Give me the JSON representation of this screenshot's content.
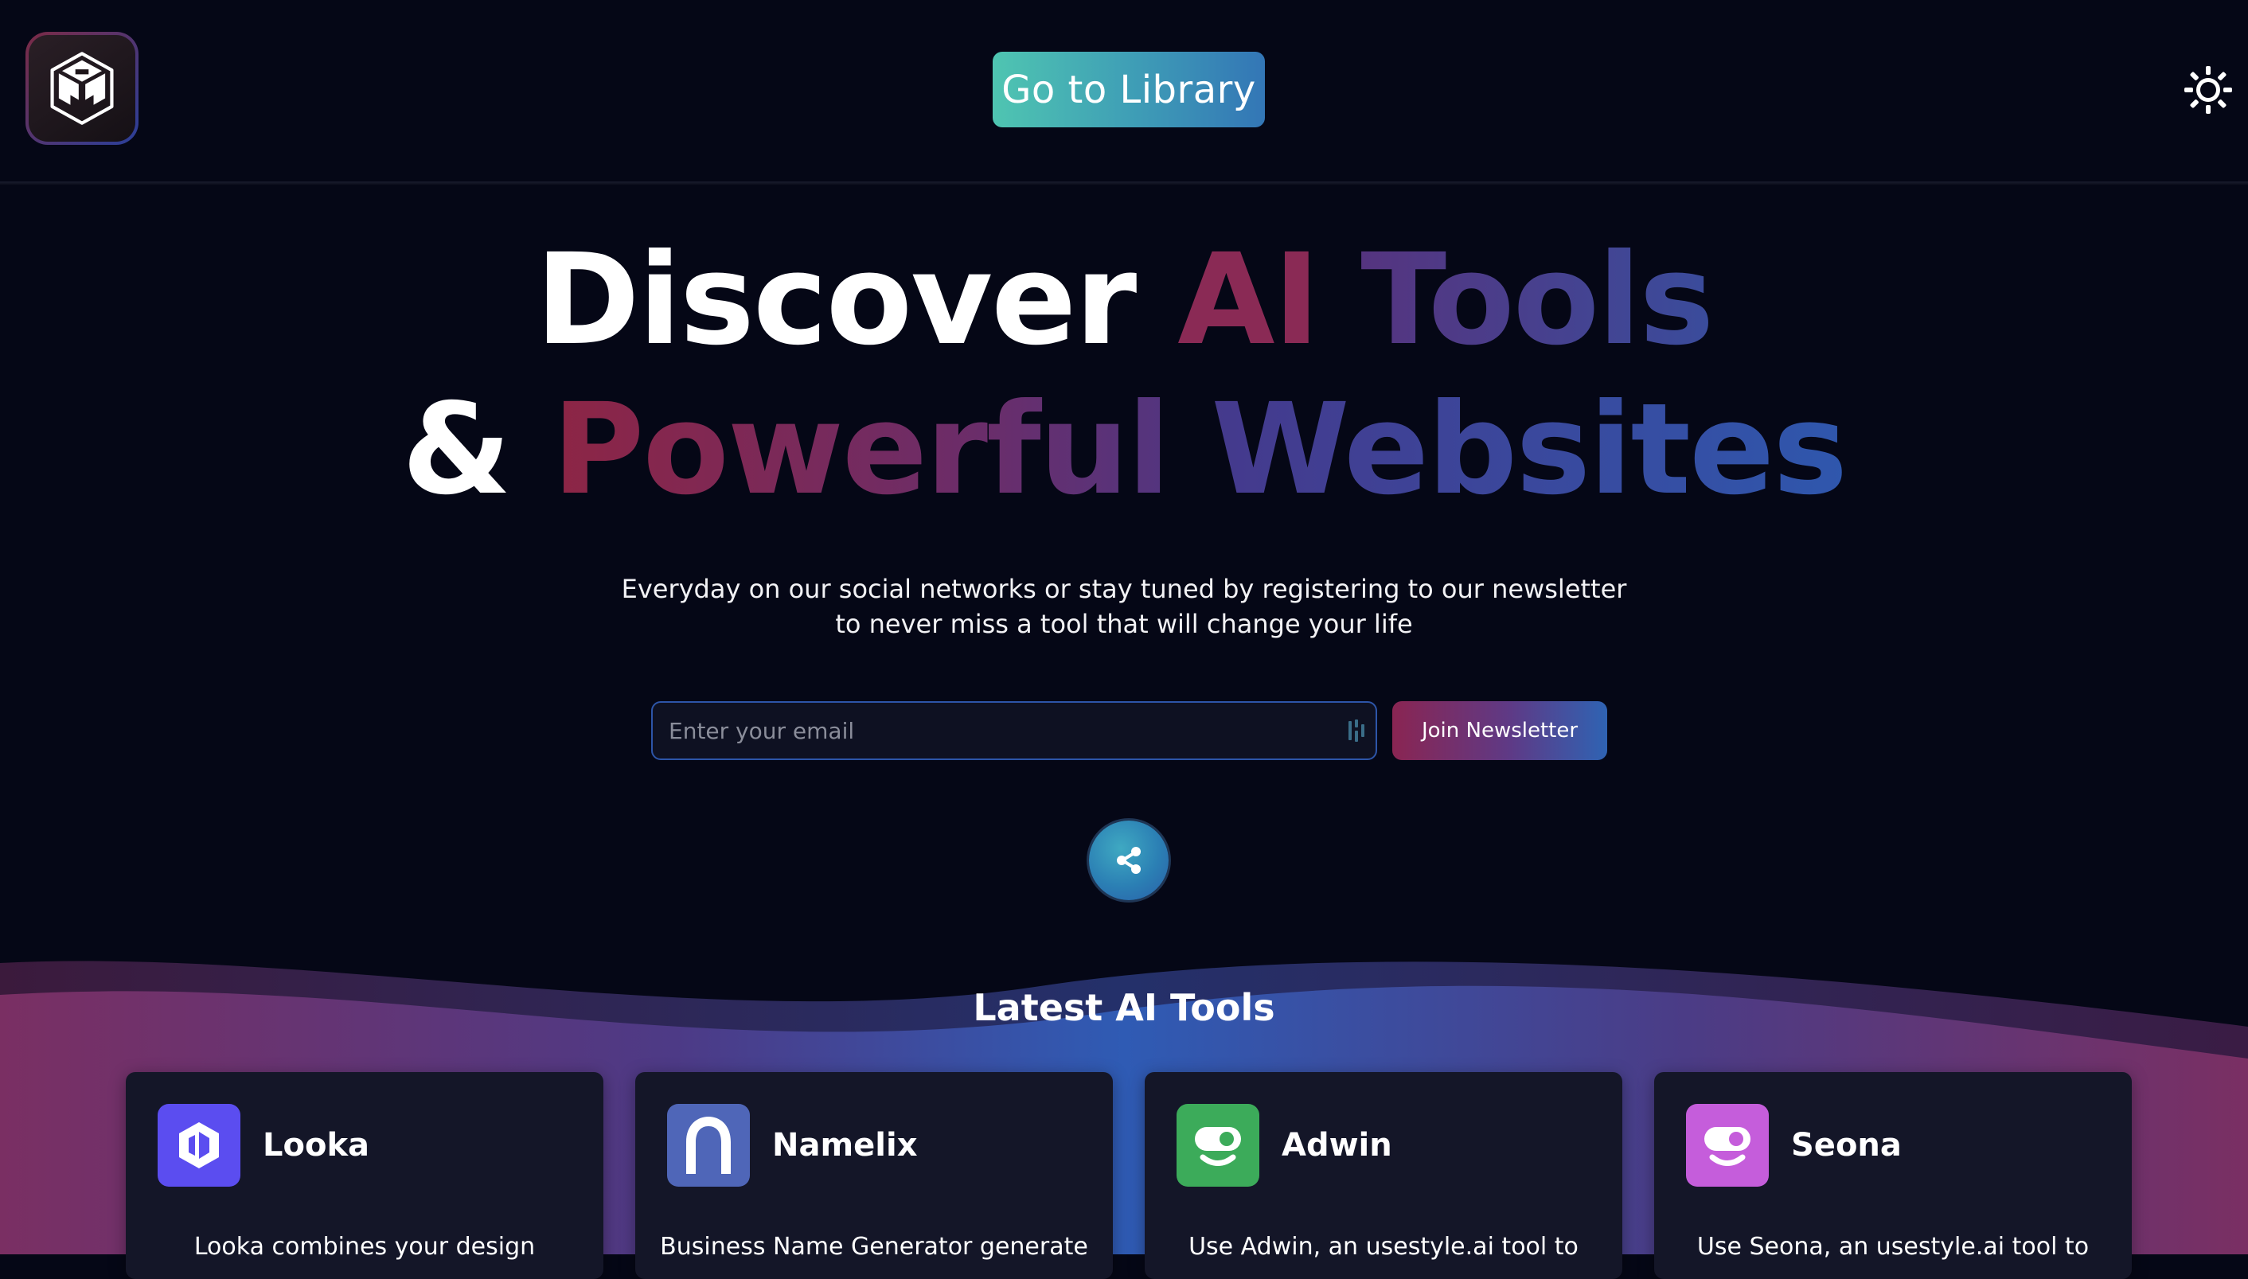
{
  "header": {
    "library_button": "Go to Library",
    "logo_icon": "cube-logo-icon",
    "theme_icon": "sun-icon"
  },
  "hero": {
    "line1": {
      "discover": "Discover",
      "ai": "AI",
      "tools": "Tools"
    },
    "line2": {
      "amp": "&",
      "powerful": "Powerful",
      "websites": "Websites"
    },
    "subtitle_line1": "Everyday on our social networks or stay tuned by registering to our newsletter",
    "subtitle_line2": "to never miss a tool that will change your life"
  },
  "newsletter": {
    "email_placeholder": "Enter your email",
    "join_label": "Join Newsletter"
  },
  "share": {
    "icon": "share-icon"
  },
  "latest": {
    "title": "Latest AI Tools",
    "cards": [
      {
        "name": "Looka",
        "description": "Looka combines your design",
        "icon_color": "#5b4df0",
        "icon": "looka-logo-icon"
      },
      {
        "name": "Namelix",
        "description": "Business Name Generator generate",
        "icon_color": "#4f66b8",
        "icon": "namelix-logo-icon"
      },
      {
        "name": "Adwin",
        "description": "Use Adwin, an usestyle.ai tool to",
        "icon_color": "#3cab5a",
        "icon": "adwin-logo-icon"
      },
      {
        "name": "Seona",
        "description": "Use Seona, an usestyle.ai tool to",
        "icon_color": "#c55ddb",
        "icon": "seona-logo-icon"
      }
    ]
  },
  "colors": {
    "background": "#050716",
    "accent_teal": "#4fc5b1",
    "accent_blue": "#3376b6",
    "accent_magenta": "#8a2552"
  }
}
